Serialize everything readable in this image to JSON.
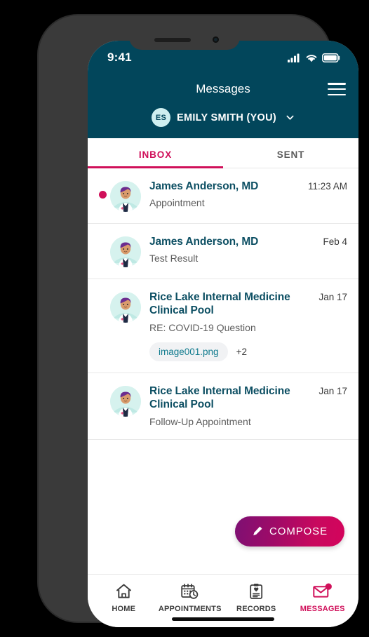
{
  "status_bar": {
    "time": "9:41",
    "signal_icon": "cellular-signal-icon",
    "wifi_icon": "wifi-icon",
    "battery_icon": "battery-icon"
  },
  "header": {
    "title": "Messages",
    "menu_icon": "hamburger-menu-icon",
    "background_color": "#02465b",
    "user": {
      "initials": "ES",
      "name": "EMILY SMITH (YOU)",
      "chevron_icon": "chevron-down-icon"
    }
  },
  "tabs": [
    {
      "label": "INBOX",
      "active": true
    },
    {
      "label": "SENT",
      "active": false
    }
  ],
  "accent_colors": {
    "primary_teal": "#02465b",
    "accent_crimson": "#d0105a",
    "sender_text": "#0d4f63",
    "attachment_text": "#107b8e"
  },
  "messages": [
    {
      "sender": "James Anderson, MD",
      "subject": "Appointment",
      "time": "11:23 AM",
      "unread": true,
      "avatar_icon": "doctor-avatar",
      "attachments": []
    },
    {
      "sender": "James Anderson, MD",
      "subject": "Test Result",
      "time": "Feb 4",
      "unread": false,
      "avatar_icon": "doctor-avatar",
      "attachments": []
    },
    {
      "sender": "Rice Lake Internal Medicine Clinical Pool",
      "subject": "RE: COVID-19 Question",
      "time": "Jan 17",
      "unread": false,
      "avatar_icon": "doctor-avatar",
      "attachments": [
        {
          "name": "image001.png"
        }
      ],
      "attachment_more": "+2"
    },
    {
      "sender": "Rice Lake Internal Medicine Clinical Pool",
      "subject": "Follow-Up Appointment",
      "time": "Jan 17",
      "unread": false,
      "avatar_icon": "doctor-avatar",
      "attachments": []
    }
  ],
  "compose": {
    "label": "COMPOSE",
    "icon": "pencil-icon"
  },
  "bottom_nav": [
    {
      "label": "HOME",
      "icon": "home-icon",
      "active": false,
      "badge": false
    },
    {
      "label": "APPOINTMENTS",
      "icon": "calendar-clock-icon",
      "active": false,
      "badge": false
    },
    {
      "label": "RECORDS",
      "icon": "clipboard-heart-icon",
      "active": false,
      "badge": false
    },
    {
      "label": "MESSAGES",
      "icon": "envelope-icon",
      "active": true,
      "badge": true
    }
  ]
}
